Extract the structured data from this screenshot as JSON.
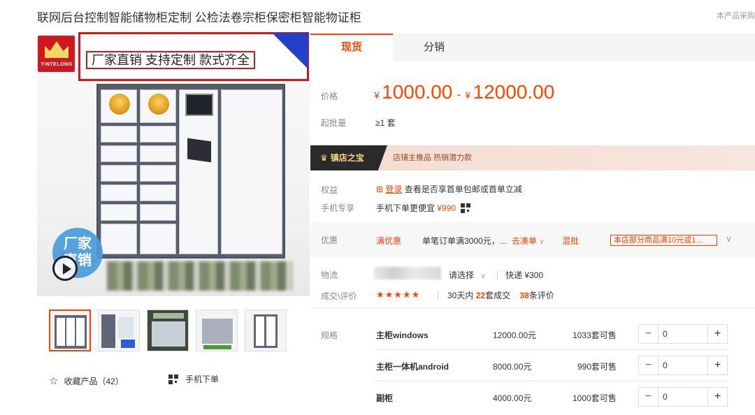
{
  "header": {
    "title": "联网后台控制智能储物柜定制  公检法卷宗柜保密柜智能物证柜",
    "right_note": "本产品采购"
  },
  "gallery": {
    "brand_text": "YINTELONG",
    "promo_banner": "厂家直销 支持定制 款式齐全",
    "video_badge_line1": "厂家",
    "video_badge_line2": "直销",
    "favorite_label": "收藏产品（42）",
    "mobile_order_label": "手机下单"
  },
  "tabs": [
    {
      "label": "现货",
      "active": true
    },
    {
      "label": "分销",
      "active": false
    }
  ],
  "price": {
    "label": "价格",
    "currency": "¥",
    "min": "1000.00",
    "dash": "-",
    "max": "12000.00",
    "color": "#ff4400"
  },
  "min_order": {
    "label": "起批量",
    "value": "≥1 套"
  },
  "store_treasure": {
    "tag": "镇店之宝",
    "text": "店铺主推品  热销潜力款"
  },
  "benefits": {
    "label": "权益",
    "login_link": "登录",
    "text": "查看是否享首单包邮或首单立减"
  },
  "mobile_exclusive": {
    "label": "手机专享",
    "text": "手机下单更便宜",
    "price": "¥990"
  },
  "discount": {
    "label": "优惠",
    "full_discount": "满优惠",
    "order_text": "单笔订单满3000元，...",
    "collect_link": "去凑单",
    "mixed_batch": "混批",
    "store_promo": "本店部分商品满10元或1..."
  },
  "logistics": {
    "label": "物流",
    "select_placeholder": "请选择",
    "express": "快递 ¥300"
  },
  "deals": {
    "label": "成交\\评价",
    "stars": "★★★★★",
    "text_prefix": "30天内",
    "sold_count": "22",
    "text_mid": "套成交",
    "review_count": "38",
    "text_suffix": "条评价"
  },
  "specs": {
    "label": "规格",
    "unit_available": "套可售",
    "rows": [
      {
        "name": "主柜windows",
        "price": "12000.00元",
        "stock": "1033",
        "qty": "0"
      },
      {
        "name": "主柜一体机android",
        "price": "8000.00元",
        "stock": "990",
        "qty": "0"
      },
      {
        "name": "副柜",
        "price": "4000.00元",
        "stock": "1000",
        "qty": "0"
      }
    ]
  }
}
